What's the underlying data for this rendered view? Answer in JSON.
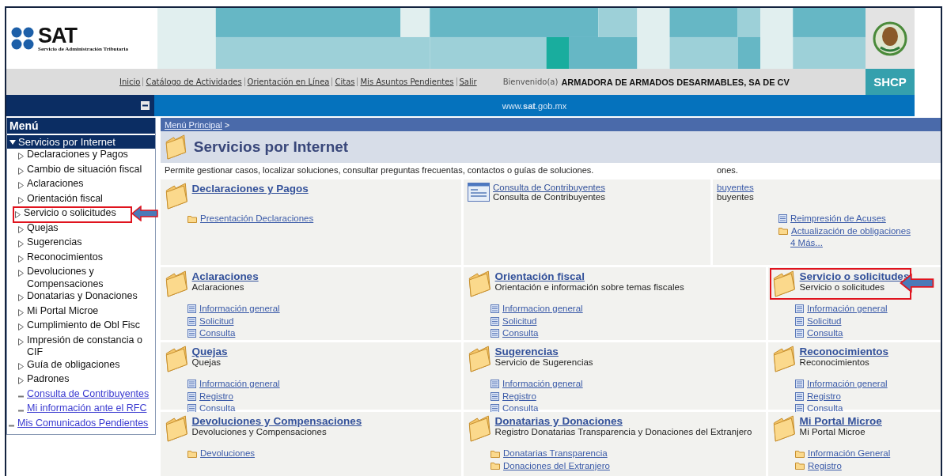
{
  "header": {
    "logo": {
      "name": "SAT",
      "subtitle": "Servicio de Administración Tributaria"
    },
    "badge": "SHCP"
  },
  "nav": {
    "links": [
      "Inicio",
      "Catálogo de Actividades",
      "Orientación en Línea",
      "Citas",
      "Mis Asuntos Pendientes",
      "Salir"
    ],
    "greeting": "Bienvenido(a)",
    "user": "ARMADORA DE ARMADOS DESARMABLES, SA DE CV"
  },
  "site_bar": {
    "url": "www.**sat**.gob.mx"
  },
  "sidebar": {
    "title": "Menú",
    "items": [
      {
        "label": "Servicios por Internet",
        "kind": "group",
        "expanded": true,
        "children": [
          {
            "label": "Declaraciones y Pagos",
            "kind": "folder",
            "highlighted": false
          },
          {
            "label": "Cambio de situación fiscal",
            "kind": "folder",
            "highlighted": false
          },
          {
            "label": "Aclaraciones",
            "kind": "folder",
            "highlighted": false
          },
          {
            "label": "Orientación fiscal",
            "kind": "folder",
            "highlighted": false
          },
          {
            "label": "Servicio o solicitudes",
            "kind": "folder",
            "highlighted": true
          },
          {
            "label": "Quejas",
            "kind": "folder",
            "highlighted": false
          },
          {
            "label": "Sugerencias",
            "kind": "folder",
            "highlighted": false
          },
          {
            "label": "Reconocimientos",
            "kind": "folder",
            "highlighted": false
          },
          {
            "label": "Devoluciones y Compensaciones",
            "kind": "folder",
            "highlighted": false
          },
          {
            "label": "Donatarias y Donaciones",
            "kind": "folder",
            "highlighted": false
          },
          {
            "label": "Mi Portal Microe",
            "kind": "folder",
            "highlighted": false
          },
          {
            "label": "Cumplimiento de Obl Fisc",
            "kind": "folder",
            "highlighted": false
          },
          {
            "label": "Impresión de constancia o CIF",
            "kind": "folder",
            "highlighted": false
          },
          {
            "label": "Guía de obligaciones",
            "kind": "folder",
            "highlighted": false
          },
          {
            "label": "Padrones",
            "kind": "folder",
            "highlighted": false
          },
          {
            "label": "Consulta de Contribuyentes",
            "kind": "link",
            "highlighted": false
          },
          {
            "label": "Mi información ante el RFC",
            "kind": "link",
            "highlighted": false
          }
        ]
      },
      {
        "label": "Mis Comunicados Pendientes",
        "kind": "link",
        "highlighted": false
      }
    ]
  },
  "breadcrumb": {
    "link": "Menú Principal",
    "separator": ">"
  },
  "page": {
    "title": "Servicios por Internet",
    "description": "Permite gestionar casos, localizar soluciones, consultar preguntas frecuentas, contactos o guías de soluciones.",
    "description_fragment": "ones."
  },
  "rows": [
    [
      {
        "kind": "folder",
        "title": "Declaraciones y Pagos",
        "highlighted": false,
        "links": [
          {
            "label": "Presentación Declaraciones",
            "kind": "folder"
          }
        ]
      },
      {
        "kind": "window",
        "title": "Consulta de Contribuyentes",
        "subtitle": "Consulta de Contribuyentes",
        "highlighted": false
      },
      {
        "kind": "fragment",
        "fragment_link": "buyentes",
        "fragment_text": "buyentes",
        "links": [
          {
            "label": "Reimpresión de Acuses",
            "kind": "page"
          },
          {
            "label": "Actualización de obligaciones",
            "kind": "folder"
          },
          {
            "label": "4 Más...",
            "kind": "more"
          }
        ]
      }
    ],
    [
      {
        "kind": "folder",
        "title": "Aclaraciones",
        "subtitle": "Aclaraciones",
        "highlighted": false,
        "links": [
          {
            "label": "Información general",
            "kind": "page"
          },
          {
            "label": "Solicitud",
            "kind": "page"
          },
          {
            "label": "Consulta",
            "kind": "page"
          }
        ]
      },
      {
        "kind": "folder",
        "title": "Orientación fiscal",
        "subtitle": "Orientación e información sobre temas fiscales",
        "highlighted": false,
        "links": [
          {
            "label": "Informacion general",
            "kind": "page"
          },
          {
            "label": "Solicitud",
            "kind": "page"
          },
          {
            "label": "Consulta",
            "kind": "page"
          }
        ]
      },
      {
        "kind": "folder",
        "title": "Servicio o solicitudes",
        "subtitle": "Servicio o solicitudes",
        "highlighted": true,
        "links": [
          {
            "label": "Información general",
            "kind": "page"
          },
          {
            "label": "Solicitud",
            "kind": "page"
          },
          {
            "label": "Consulta",
            "kind": "page"
          }
        ]
      }
    ],
    [
      {
        "kind": "folder",
        "title": "Quejas",
        "subtitle": "Quejas",
        "highlighted": false,
        "links": [
          {
            "label": "Información general",
            "kind": "page"
          },
          {
            "label": "Registro",
            "kind": "page"
          },
          {
            "label": "Consulta",
            "kind": "page"
          }
        ]
      },
      {
        "kind": "folder",
        "title": "Sugerencias",
        "subtitle": "Servicio de Sugerencias",
        "highlighted": false,
        "links": [
          {
            "label": "Información general",
            "kind": "page"
          },
          {
            "label": "Registro",
            "kind": "page"
          },
          {
            "label": "Consulta",
            "kind": "page"
          }
        ]
      },
      {
        "kind": "folder",
        "title": "Reconocimientos",
        "subtitle": "Reconocimientos",
        "highlighted": false,
        "links": [
          {
            "label": "Información general",
            "kind": "page"
          },
          {
            "label": "Registro",
            "kind": "page"
          },
          {
            "label": "Consulta",
            "kind": "page"
          }
        ]
      }
    ],
    [
      {
        "kind": "folder",
        "title": "Devoluciones y Compensaciones",
        "subtitle": "Devoluciones y Compensaciones",
        "highlighted": false,
        "links": [
          {
            "label": "Devoluciones",
            "kind": "folder"
          }
        ]
      },
      {
        "kind": "folder",
        "title": "Donatarias y Donaciones",
        "subtitle": "Registro Donatarias Transparencia y Donaciones del Extranjero",
        "highlighted": false,
        "links": [
          {
            "label": "Donatarias Transparencia",
            "kind": "folder"
          },
          {
            "label": "Donaciones del Extranjero",
            "kind": "folder"
          }
        ]
      },
      {
        "kind": "folder",
        "title": "Mi Portal Microe",
        "subtitle": "Mi Portal Microe",
        "highlighted": false,
        "links": [
          {
            "label": "Información General",
            "kind": "folder"
          },
          {
            "label": "Registro",
            "kind": "folder"
          }
        ]
      }
    ]
  ]
}
